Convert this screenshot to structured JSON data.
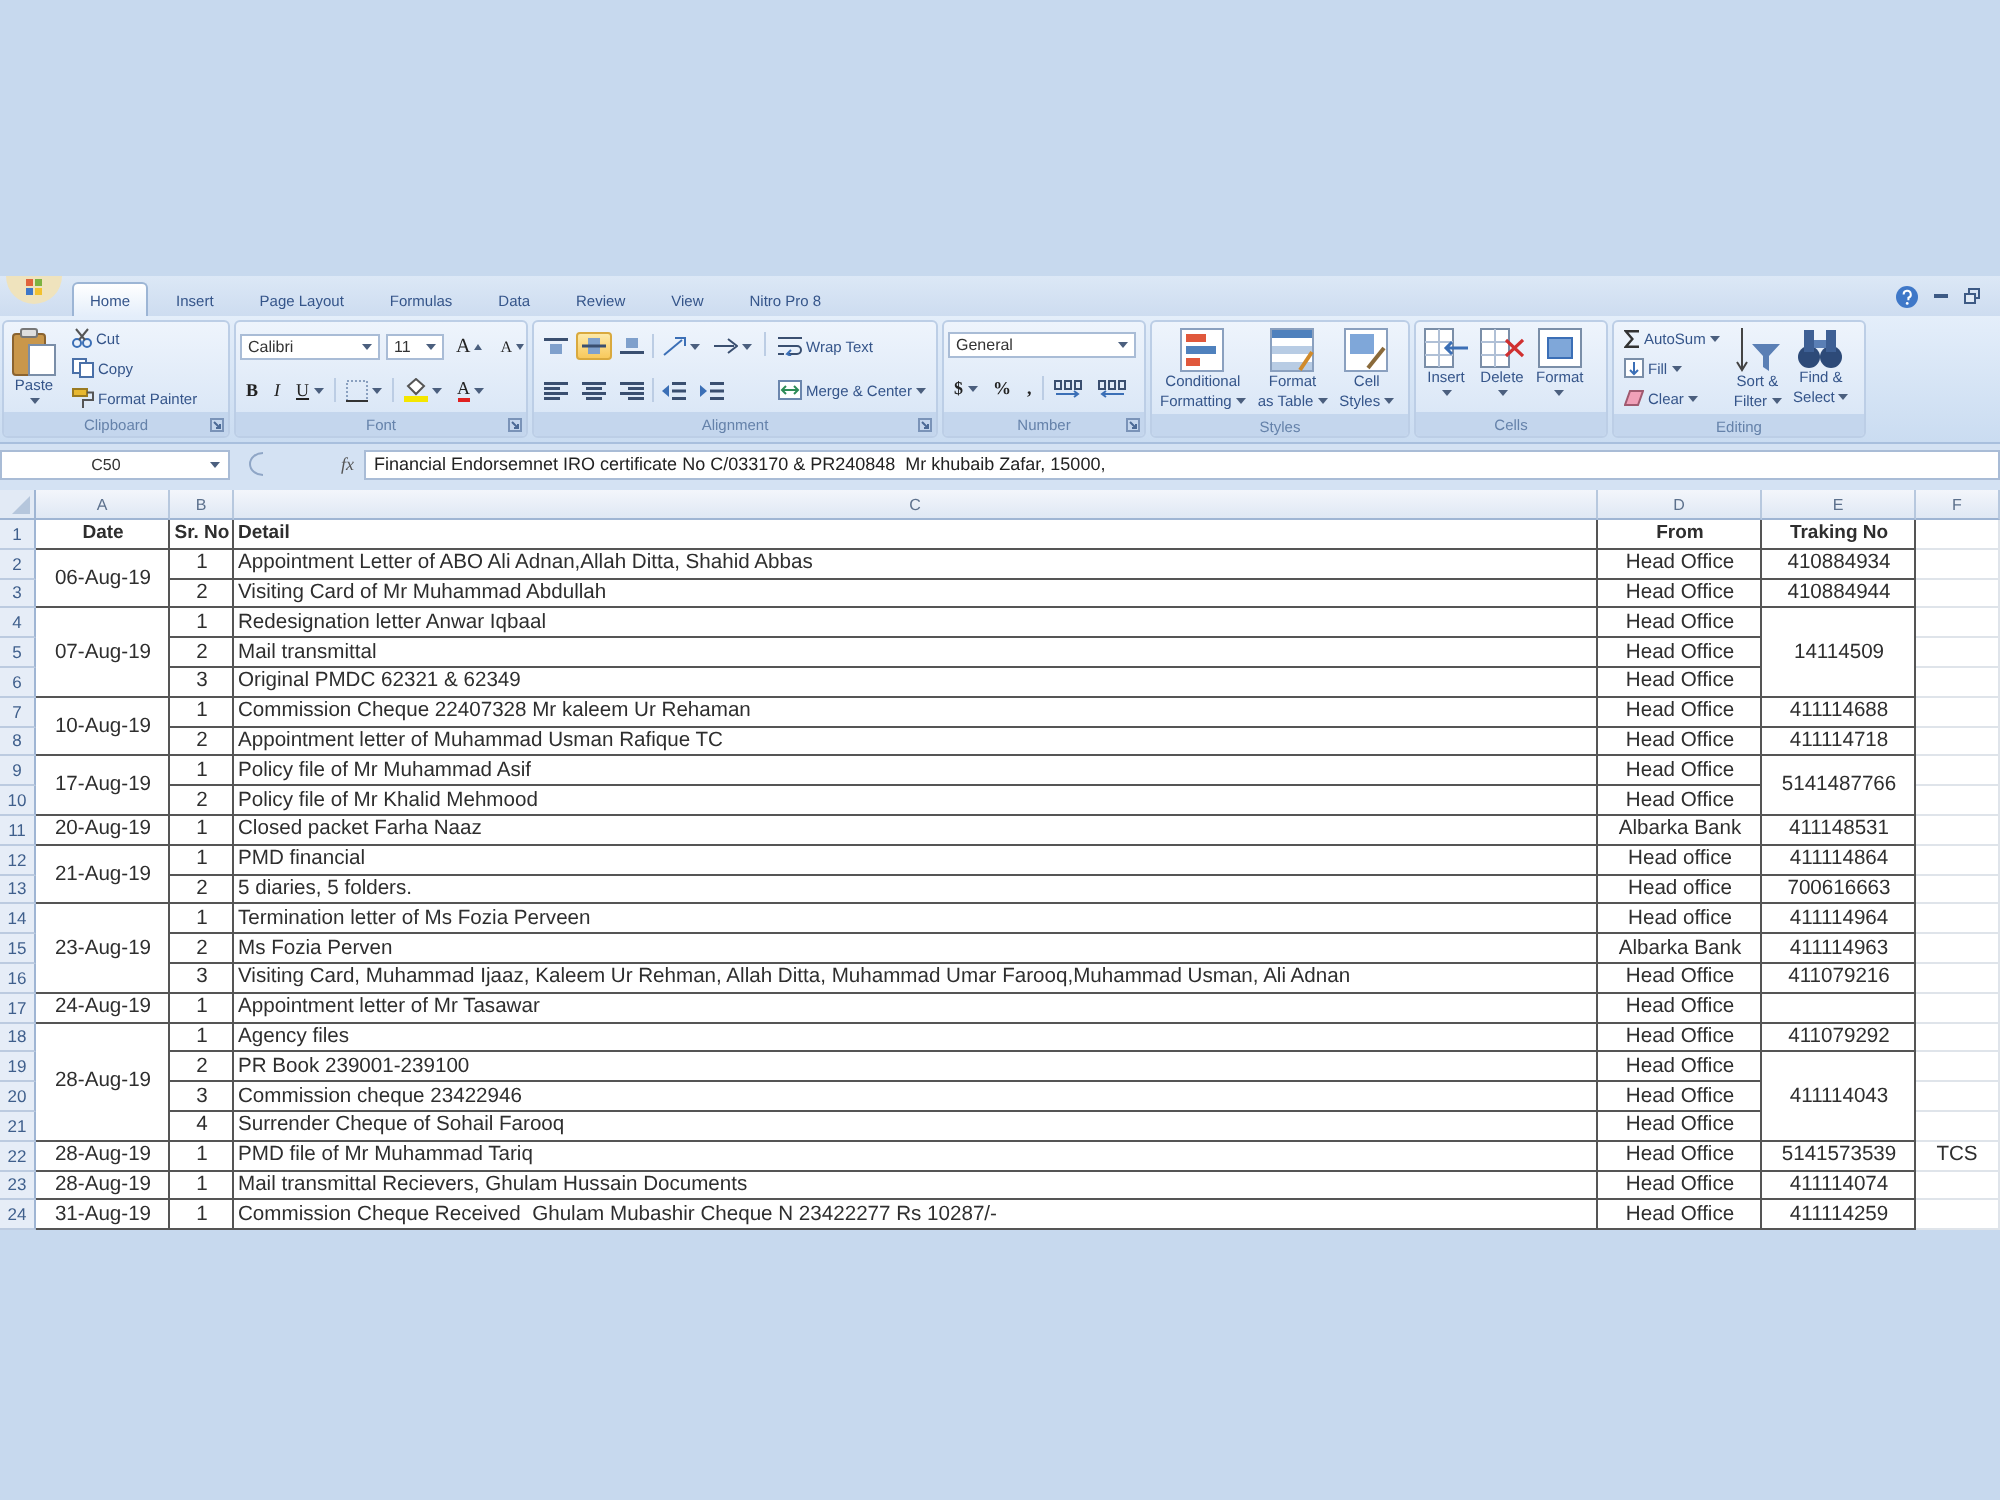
{
  "tabs": [
    {
      "label": "Home",
      "selected": true
    },
    {
      "label": "Insert",
      "selected": false
    },
    {
      "label": "Page Layout",
      "selected": false
    },
    {
      "label": "Formulas",
      "selected": false
    },
    {
      "label": "Data",
      "selected": false
    },
    {
      "label": "Review",
      "selected": false
    },
    {
      "label": "View",
      "selected": false
    },
    {
      "label": "Nitro Pro 8",
      "selected": false
    }
  ],
  "ribbon": {
    "clipboard": {
      "label": "Clipboard",
      "paste": "Paste",
      "cut": "Cut",
      "copy": "Copy",
      "format_painter": "Format Painter"
    },
    "font": {
      "label": "Font",
      "font_name": "Calibri",
      "font_size": "11",
      "grow_font": "A",
      "shrink_font": "A",
      "bold": "B",
      "italic": "I",
      "underline": "U",
      "font_color": "A"
    },
    "alignment": {
      "label": "Alignment",
      "vertical": [
        {
          "kind": "top",
          "selected": false
        },
        {
          "kind": "middle",
          "selected": true
        },
        {
          "kind": "bottom",
          "selected": false
        }
      ],
      "wrap_text": "Wrap Text",
      "merge_center": "Merge & Center"
    },
    "number": {
      "label": "Number",
      "format": "General",
      "currency": "$",
      "percent": "%",
      "comma": ","
    },
    "styles": {
      "label": "Styles",
      "buttons": [
        {
          "kind": "conditional",
          "lines": [
            "Conditional",
            "Formatting"
          ]
        },
        {
          "kind": "table",
          "lines": [
            "Format",
            "as Table"
          ]
        },
        {
          "kind": "cell_styles",
          "lines": [
            "Cell",
            "Styles"
          ]
        }
      ]
    },
    "cells": {
      "label": "Cells",
      "buttons": [
        {
          "kind": "insert",
          "label": "Insert"
        },
        {
          "kind": "delete",
          "label": "Delete"
        },
        {
          "kind": "format",
          "label": "Format"
        }
      ]
    },
    "editing": {
      "label": "Editing",
      "autosum": "AutoSum",
      "fill": "Fill",
      "clear": "Clear",
      "buttons": [
        {
          "kind": "sort",
          "lines": [
            "Sort &",
            "Filter"
          ]
        },
        {
          "kind": "find",
          "lines": [
            "Find &",
            "Select"
          ]
        }
      ]
    }
  },
  "formula_bar": {
    "name_box": "C50",
    "function_label": "fx",
    "formula": "Financial Endorsemnet IRO certificate No C/033170 & PR240848  Mr khubaib Zafar, 15000,"
  },
  "sheet": {
    "columns": [
      "A",
      "B",
      "C",
      "D",
      "E",
      "F"
    ],
    "header": {
      "row": "1",
      "cells": [
        "Date",
        "Sr. No",
        "Detail",
        "From",
        "Traking No"
      ]
    },
    "groups": [
      {
        "date": "06-Aug-19",
        "blocks": [
          {
            "tracking": "410884934",
            "entries": [
              {
                "row": "2",
                "sr_no": "1",
                "detail": "Appointment Letter of ABO Ali Adnan,Allah Ditta, Shahid Abbas",
                "from": "Head Office"
              }
            ]
          },
          {
            "tracking": "410884944",
            "entries": [
              {
                "row": "3",
                "sr_no": "2",
                "detail": "Visiting Card of Mr Muhammad Abdullah",
                "from": "Head Office"
              }
            ]
          }
        ]
      },
      {
        "date": "07-Aug-19",
        "blocks": [
          {
            "tracking": "14114509",
            "entries": [
              {
                "row": "4",
                "sr_no": "1",
                "detail": "Redesignation letter Anwar Iqbaal",
                "from": "Head Office"
              },
              {
                "row": "5",
                "sr_no": "2",
                "detail": "Mail transmittal",
                "from": "Head Office"
              },
              {
                "row": "6",
                "sr_no": "3",
                "detail": "Original PMDC 62321 & 62349",
                "from": "Head Office"
              }
            ]
          }
        ]
      },
      {
        "date": "10-Aug-19",
        "blocks": [
          {
            "tracking": "411114688",
            "entries": [
              {
                "row": "7",
                "sr_no": "1",
                "detail": "Commission Cheque 22407328 Mr kaleem Ur Rehaman",
                "from": "Head Office"
              }
            ]
          },
          {
            "tracking": "411114718",
            "entries": [
              {
                "row": "8",
                "sr_no": "2",
                "detail": "Appointment letter of Muhammad Usman Rafique TC",
                "from": "Head Office"
              }
            ]
          }
        ]
      },
      {
        "date": "17-Aug-19",
        "blocks": [
          {
            "tracking": "5141487766",
            "entries": [
              {
                "row": "9",
                "sr_no": "1",
                "detail": "Policy file of Mr Muhammad Asif",
                "from": "Head Office"
              },
              {
                "row": "10",
                "sr_no": "2",
                "detail": "Policy file of Mr Khalid Mehmood",
                "from": "Head Office"
              }
            ]
          }
        ]
      },
      {
        "date": "20-Aug-19",
        "blocks": [
          {
            "tracking": "411148531",
            "entries": [
              {
                "row": "11",
                "sr_no": "1",
                "detail": "Closed packet Farha Naaz",
                "from": "Albarka Bank"
              }
            ]
          }
        ]
      },
      {
        "date": "21-Aug-19",
        "blocks": [
          {
            "tracking": "411114864",
            "entries": [
              {
                "row": "12",
                "sr_no": "1",
                "detail": "PMD financial",
                "from": "Head office"
              }
            ]
          },
          {
            "tracking": "700616663",
            "entries": [
              {
                "row": "13",
                "sr_no": "2",
                "detail": "5 diaries, 5 folders.",
                "from": "Head office"
              }
            ]
          }
        ]
      },
      {
        "date": "23-Aug-19",
        "blocks": [
          {
            "tracking": "411114964",
            "entries": [
              {
                "row": "14",
                "sr_no": "1",
                "detail": "Termination letter of Ms Fozia Perveen",
                "from": "Head office"
              }
            ]
          },
          {
            "tracking": "411114963",
            "entries": [
              {
                "row": "15",
                "sr_no": "2",
                "detail": "Ms Fozia Perven",
                "from": "Albarka Bank"
              }
            ]
          },
          {
            "tracking": "411079216",
            "entries": [
              {
                "row": "16",
                "sr_no": "3",
                "detail": "Visiting Card, Muhammad Ijaaz, Kaleem Ur Rehman, Allah Ditta, Muhammad Umar Farooq,Muhammad Usman, Ali Adnan",
                "from": "Head Office"
              }
            ]
          }
        ]
      },
      {
        "date": "24-Aug-19",
        "blocks": [
          {
            "entries": [
              {
                "row": "17",
                "sr_no": "1",
                "detail": "Appointment letter of Mr Tasawar",
                "from": "Head Office"
              }
            ]
          }
        ]
      },
      {
        "date": "28-Aug-19",
        "blocks": [
          {
            "tracking": "411079292",
            "entries": [
              {
                "row": "18",
                "sr_no": "1",
                "detail": "Agency files",
                "from": "Head Office"
              }
            ]
          },
          {
            "tracking": "411114043",
            "entries": [
              {
                "row": "19",
                "sr_no": "2",
                "detail": "PR Book 239001-239100",
                "from": "Head Office"
              },
              {
                "row": "20",
                "sr_no": "3",
                "detail": "Commission cheque 23422946",
                "from": "Head Office"
              },
              {
                "row": "21",
                "sr_no": "4",
                "detail": "Surrender Cheque of Sohail Farooq",
                "from": "Head Office"
              }
            ]
          }
        ]
      },
      {
        "date": "28-Aug-19",
        "blocks": [
          {
            "tracking": "5141573539",
            "entries": [
              {
                "row": "22",
                "sr_no": "1",
                "detail": "PMD file of Mr Muhammad Tariq",
                "from": "Head Office",
                "column_f": "TCS"
              }
            ]
          }
        ]
      },
      {
        "date": "28-Aug-19",
        "blocks": [
          {
            "tracking": "411114074",
            "entries": [
              {
                "row": "23",
                "sr_no": "1",
                "detail": "Mail transmittal Recievers, Ghulam Hussain Documents",
                "from": "Head Office"
              }
            ]
          }
        ]
      },
      {
        "date": "31-Aug-19",
        "blocks": [
          {
            "tracking": "411114259",
            "entries": [
              {
                "row": "24",
                "sr_no": "1",
                "detail": "Commission Cheque Received  Ghulam Mubashir Cheque N 23422277 Rs 10287/-",
                "from": "Head Office"
              }
            ]
          }
        ]
      }
    ]
  }
}
